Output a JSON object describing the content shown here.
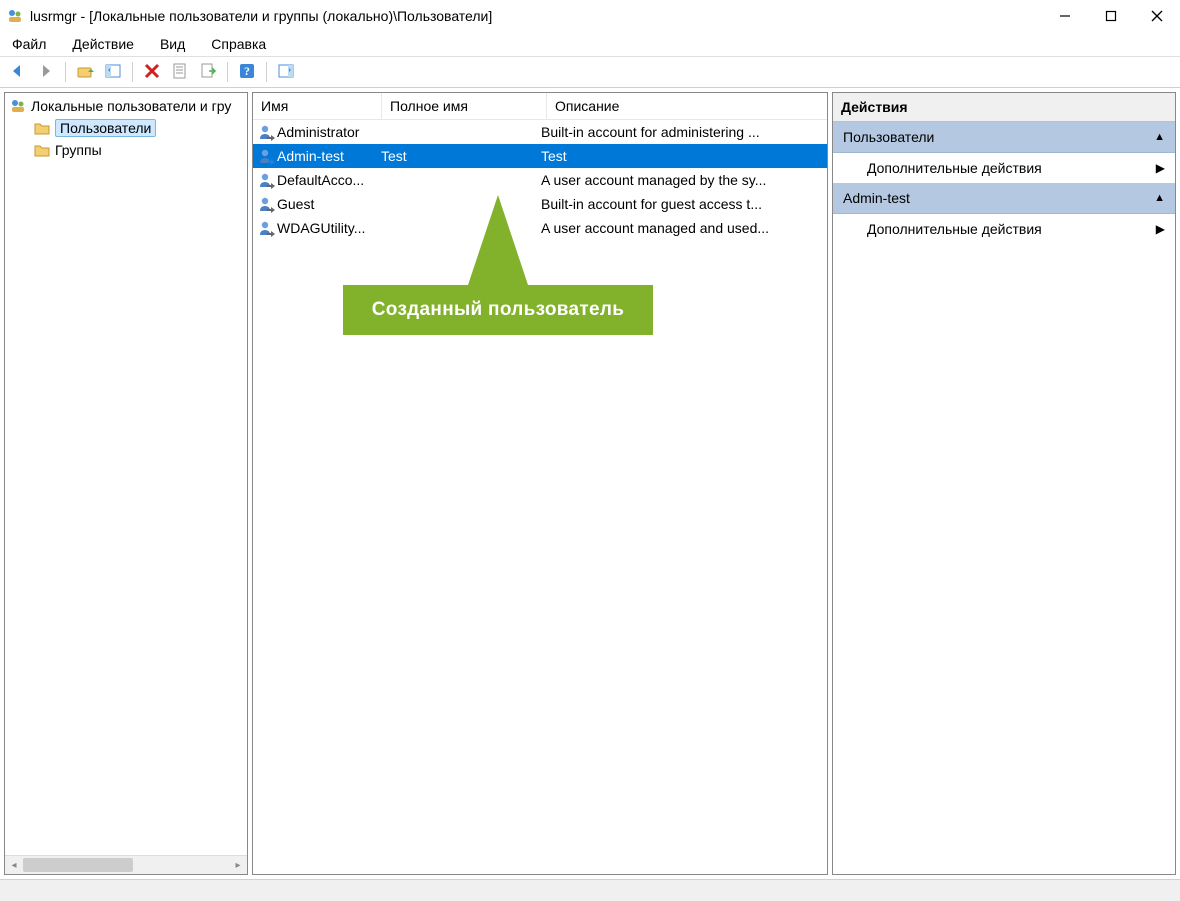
{
  "window": {
    "title": "lusrmgr - [Локальные пользователи и группы (локально)\\Пользователи]"
  },
  "menu": {
    "file": "Файл",
    "action": "Действие",
    "view": "Вид",
    "help": "Справка"
  },
  "toolbar_icons": {
    "back": "back-icon",
    "forward": "forward-icon",
    "up": "up-icon",
    "show_hide": "show-hide-icon",
    "delete": "delete-icon",
    "properties": "properties-icon",
    "refresh": "refresh-icon",
    "help": "help-icon",
    "show_actions": "show-actions-icon"
  },
  "tree": {
    "root": "Локальные пользователи и гру",
    "users": "Пользователи",
    "groups": "Группы"
  },
  "list": {
    "columns": {
      "name": "Имя",
      "fullname": "Полное имя",
      "description": "Описание"
    },
    "rows": [
      {
        "name": "Administrator",
        "fullname": "",
        "description": "Built-in account for administering ...",
        "selected": false,
        "disabled": true
      },
      {
        "name": "Admin-test",
        "fullname": "Test",
        "description": "Test",
        "selected": true,
        "disabled": false
      },
      {
        "name": "DefaultAcco...",
        "fullname": "",
        "description": "A user account managed by the sy...",
        "selected": false,
        "disabled": true
      },
      {
        "name": "Guest",
        "fullname": "",
        "description": "Built-in account for guest access t...",
        "selected": false,
        "disabled": true
      },
      {
        "name": "WDAGUtility...",
        "fullname": "",
        "description": "A user account managed and used...",
        "selected": false,
        "disabled": true
      }
    ]
  },
  "actions": {
    "title": "Действия",
    "section1": "Пользователи",
    "item1": "Дополнительные действия",
    "section2": "Admin-test",
    "item2": "Дополнительные действия"
  },
  "callout": {
    "text": "Созданный пользователь"
  }
}
